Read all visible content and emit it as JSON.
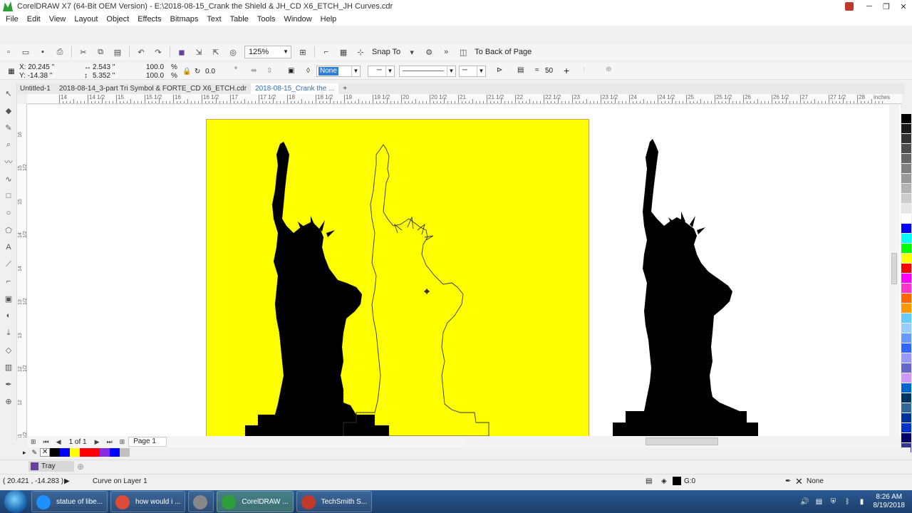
{
  "window": {
    "title": "CorelDRAW X7 (64-Bit OEM Version) - E:\\2018-08-15_Crank the Shield & JH_CD X6_ETCH_JH Curves.cdr",
    "controls": [
      "─",
      "❐",
      "✕"
    ]
  },
  "menu": [
    "File",
    "Edit",
    "View",
    "Layout",
    "Object",
    "Effects",
    "Bitmaps",
    "Text",
    "Table",
    "Tools",
    "Window",
    "Help"
  ],
  "toolbar": {
    "zoom": "125%",
    "snap_to": "Snap To",
    "to_back": "To Back of Page"
  },
  "property_bar": {
    "x": "X: 20.245 \"",
    "y": "Y: -14.38 \"",
    "width": "2.543 \"",
    "height": "5.352 \"",
    "scale_w": "100.0",
    "scale_h": "100.0",
    "pct": "%",
    "angle": "0.0",
    "degree": "°",
    "fill": "None",
    "smoothing": "50"
  },
  "doc_tabs": [
    {
      "label": "Untitled-1"
    },
    {
      "label": "2018-08-14_3-part Tri Symbol & FORTE_CD X6_ETCH.cdr"
    },
    {
      "label": "2018-08-15_Crank the ..."
    }
  ],
  "ruler": {
    "labels": [
      "14",
      "14 1/2",
      "15",
      "15 1/2",
      "16",
      "16 1/2",
      "17",
      "17 1/2",
      "18",
      "18 1/2",
      "19",
      "19 1/2",
      "20",
      "20 1/2",
      "21",
      "21 1/2",
      "22",
      "22 1/2",
      "23",
      "23 1/2",
      "24",
      "24 1/2",
      "25",
      "25 1/2",
      "26",
      "26 1/2",
      "27",
      "27 1/2",
      "28"
    ],
    "unit": "inches",
    "vlabels": [
      "11 1/2",
      "12",
      "12 1/2",
      "13",
      "13 1/2",
      "14",
      "14 1/2",
      "15",
      "15 1/2",
      "16"
    ]
  },
  "page_nav": {
    "count": "1 of 1",
    "page_tab": "Page 1"
  },
  "tray": {
    "label": "Tray"
  },
  "status": {
    "coords": "( 20.421 , -14.283 )",
    "object": "Curve on Layer 1",
    "fill_color_value": "G:0",
    "outline": "None"
  },
  "palette_colors": [
    "#000000",
    "#1a1a1a",
    "#333333",
    "#4d4d4d",
    "#666666",
    "#808080",
    "#999999",
    "#b3b3b3",
    "#cccccc",
    "#e6e6e6",
    "#ffffff",
    "#0000ff",
    "#00ffff",
    "#00ff00",
    "#ffff00",
    "#ff0000",
    "#ff00ff",
    "#ff33cc",
    "#ff6600",
    "#ff9900",
    "#66ccff",
    "#99ccff",
    "#6699ff",
    "#3366ff",
    "#9999ff",
    "#6666cc",
    "#cc99ff",
    "#0066cc",
    "#003366",
    "#336699",
    "#003399",
    "#0033cc",
    "#000066",
    "#333399"
  ],
  "doc_palette": [
    "#000000",
    "#0000ff",
    "#ffff00",
    "#ff0000",
    "#ff0000",
    "#8a2be2",
    "#0000ff",
    "#c0c0c0"
  ],
  "taskbar": {
    "tasks": [
      {
        "label": "statue of libe...",
        "color": "#1e90ff"
      },
      {
        "label": "how would i ...",
        "color": "#dd4b39"
      },
      {
        "label": "",
        "color": "#888888"
      },
      {
        "label": "CorelDRAW ...",
        "color": "#2e9e3a"
      },
      {
        "label": "TechSmith S...",
        "color": "#c0392b"
      }
    ],
    "time": "8:26 AM",
    "date": "8/19/2018"
  }
}
